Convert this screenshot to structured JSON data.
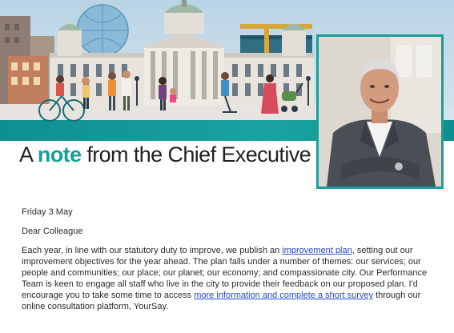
{
  "headline": {
    "prefix": "A ",
    "accent": "note",
    "suffix": " from the Chief Executive"
  },
  "letter": {
    "date": "Friday 3 May",
    "greeting": "Dear Colleague",
    "para1_part1": "Each year, in line with our statutory duty to improve, we publish an ",
    "link1": "improvement plan",
    "para1_part2": ", setting out our improvement objectives for the year ahead.  The plan falls under a number of themes: our services; our people and communities; our place; our planet; our economy; and compassionate city.  Our Performance Team is keen to engage all staff who live in the city to provide their feedback on our proposed plan.  I'd encourage you to take some time to access ",
    "link2": "more information and complete a short survey",
    "para1_part3": " through our online consultation platform, YourSay."
  },
  "colors": {
    "teal": "#14a09d",
    "link": "#2447c9"
  },
  "icons": {
    "banner": "city-hall-illustration",
    "portrait": "chief-executive-photo"
  }
}
